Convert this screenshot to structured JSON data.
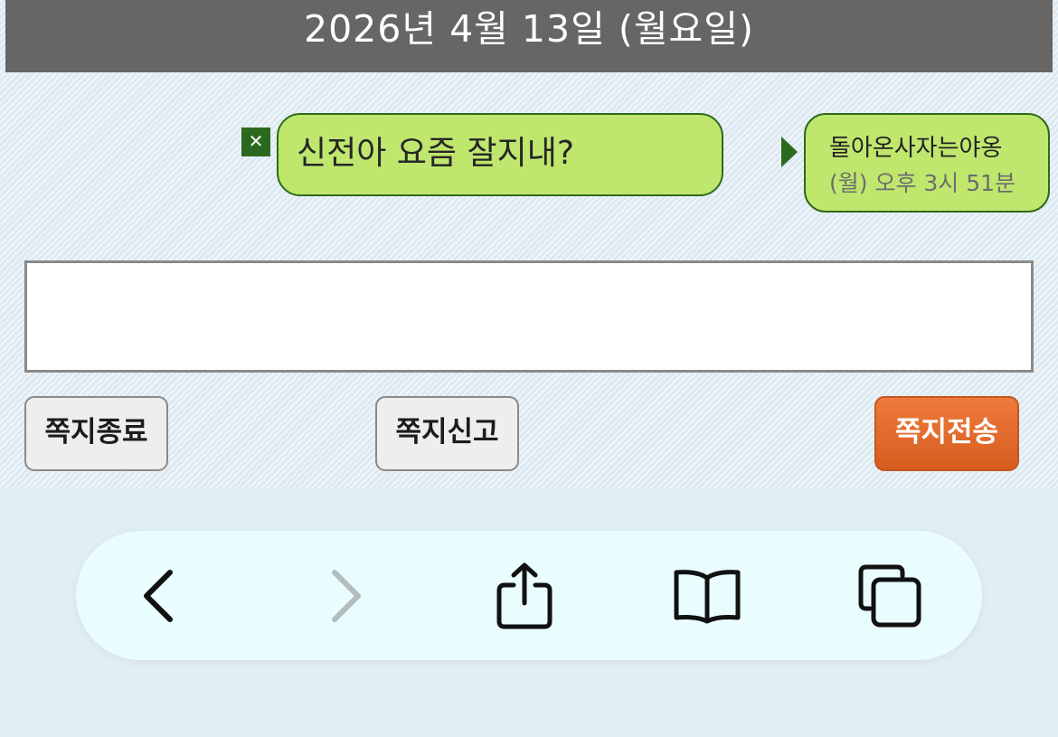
{
  "header": {
    "date": "2026년 4월 13일 (월요일)"
  },
  "message": {
    "text": "신전아 요즘 잘지내?",
    "delete_icon": "close-icon"
  },
  "sender": {
    "name": "돌아온사자는야옹",
    "time": "(월) 오후 3시 51분"
  },
  "input": {
    "value": "",
    "placeholder": ""
  },
  "buttons": {
    "end_label": "쪽지종료",
    "report_label": "쪽지신고",
    "send_label": "쪽지전송"
  },
  "browser_toolbar": {
    "items": [
      "back-icon",
      "forward-icon",
      "share-icon",
      "bookmarks-icon",
      "tabs-icon"
    ]
  },
  "colors": {
    "header_bg": "#666666",
    "bubble_bg": "#bfe76e",
    "bubble_border": "#2e6a1a",
    "send_button": "#e0662a",
    "toolbar_bg": "#eafdfe"
  }
}
